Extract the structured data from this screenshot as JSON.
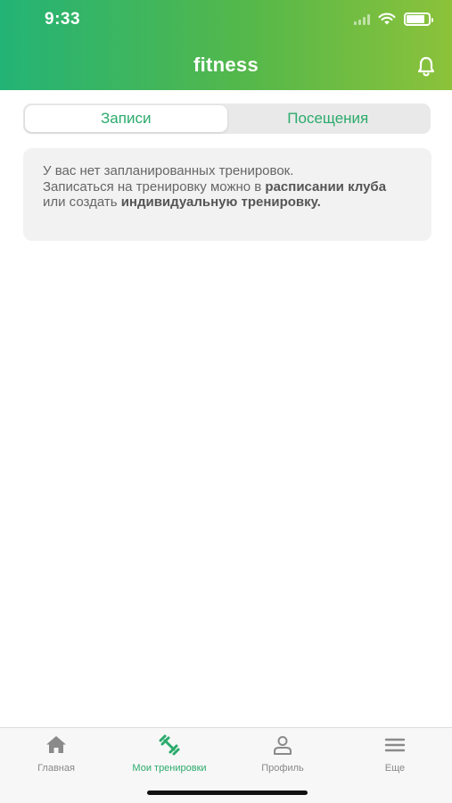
{
  "status_bar": {
    "time": "9:33",
    "battery_level": 0.85
  },
  "header": {
    "title": "fitness"
  },
  "segments": [
    {
      "label": "Записи",
      "active": true
    },
    {
      "label": "Посещения",
      "active": false
    }
  ],
  "info": {
    "line1": "У вас нет запланированных тренировок.",
    "part1": "Записаться на тренировку можно в ",
    "link1": "расписании клуба",
    "part2": " или создать ",
    "link2": "индивидуальную тренировку."
  },
  "tabbar": {
    "items": [
      {
        "label": "Главная",
        "icon": "home-icon",
        "active": false
      },
      {
        "label": "Мои тренировки",
        "icon": "dumbbell-icon",
        "active": true
      },
      {
        "label": "Профиль",
        "icon": "profile-icon",
        "active": false
      },
      {
        "label": "Еще",
        "icon": "menu-icon",
        "active": false
      }
    ]
  },
  "colors": {
    "accent": "#2bab6c",
    "header_start": "#23b376",
    "header_end": "#8cc23a"
  }
}
